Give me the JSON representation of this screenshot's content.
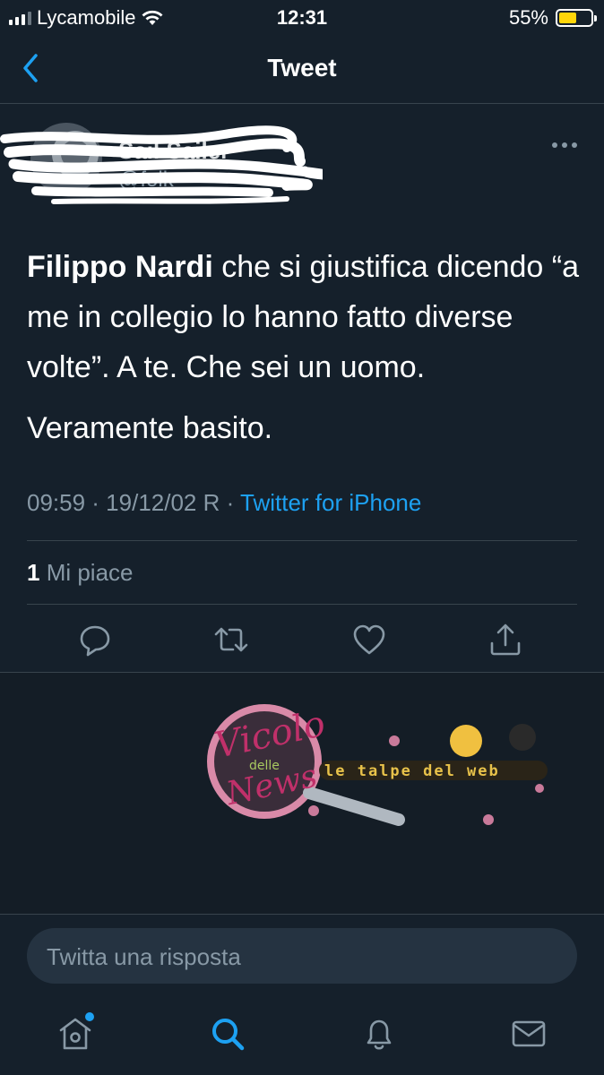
{
  "status_bar": {
    "carrier": "Lycamobile",
    "time": "12:31",
    "battery": "55%",
    "battery_level": 0.55,
    "battery_color": "#ffd60a"
  },
  "header": {
    "title": "Tweet",
    "back_icon": "chevron-left-icon"
  },
  "author": {
    "name": "Sail Sailer",
    "handle": "@folk",
    "more_icon": "more-icon"
  },
  "tweet": {
    "mention": "Filippo Nardi",
    "text_rest": " che si giustifica dicendo “a me in collegio lo hanno fatto diverse volte”. A te. Che sei un uomo.",
    "text_second": "Veramente basito.",
    "timestamp": "09:59 · 19/12/02 R · ",
    "source": "Twitter for iPhone"
  },
  "likes": {
    "count": "1",
    "label": " Mi piace"
  },
  "actions": [
    {
      "name": "reply-icon"
    },
    {
      "name": "retweet-icon"
    },
    {
      "name": "like-icon"
    },
    {
      "name": "share-icon"
    }
  ],
  "watermark": {
    "logo_text_1": "Vicolo",
    "logo_text_2": "delle",
    "logo_text_3": "News",
    "tagline": "le talpe del web"
  },
  "reply": {
    "placeholder": "Twitta una risposta"
  },
  "bottom_nav": [
    {
      "name": "home-icon"
    },
    {
      "name": "search-icon"
    },
    {
      "name": "notifications-icon"
    },
    {
      "name": "messages-icon"
    }
  ],
  "colors": {
    "background": "#15202b",
    "accent": "#1da1f2",
    "muted": "#8899a6",
    "border": "#38444d"
  }
}
